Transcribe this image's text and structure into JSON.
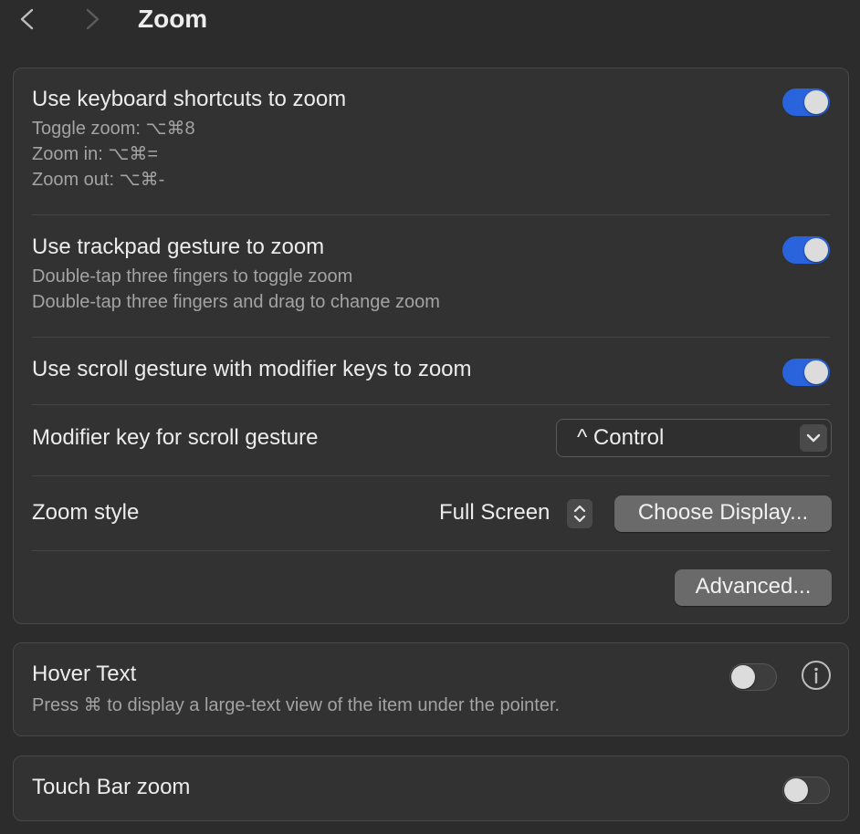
{
  "header": {
    "title": "Zoom",
    "back_icon": "chevron-left-icon",
    "forward_icon": "chevron-right-icon"
  },
  "zoom_group": {
    "keyboard": {
      "title": "Use keyboard shortcuts to zoom",
      "lines": [
        "Toggle zoom: ⌥⌘8",
        "Zoom in: ⌥⌘=",
        "Zoom out: ⌥⌘-"
      ],
      "enabled": true
    },
    "trackpad": {
      "title": "Use trackpad gesture to zoom",
      "lines": [
        "Double-tap three fingers to toggle zoom",
        "Double-tap three fingers and drag to change zoom"
      ],
      "enabled": true
    },
    "scroll": {
      "title": "Use scroll gesture with modifier keys to zoom",
      "enabled": true
    },
    "modifier": {
      "title": "Modifier key for scroll gesture",
      "value": "^ Control"
    },
    "style": {
      "title": "Zoom style",
      "value": "Full Screen",
      "choose_display_label": "Choose Display..."
    },
    "advanced_label": "Advanced..."
  },
  "hover_group": {
    "title": "Hover Text",
    "description": "Press ⌘ to display a large-text view of the item under the pointer.",
    "enabled": false
  },
  "touchbar_group": {
    "title": "Touch Bar zoom",
    "enabled": false
  },
  "colors": {
    "accent": "#2a64dc",
    "background": "#2c2c2c",
    "group_bg": "#323232"
  }
}
